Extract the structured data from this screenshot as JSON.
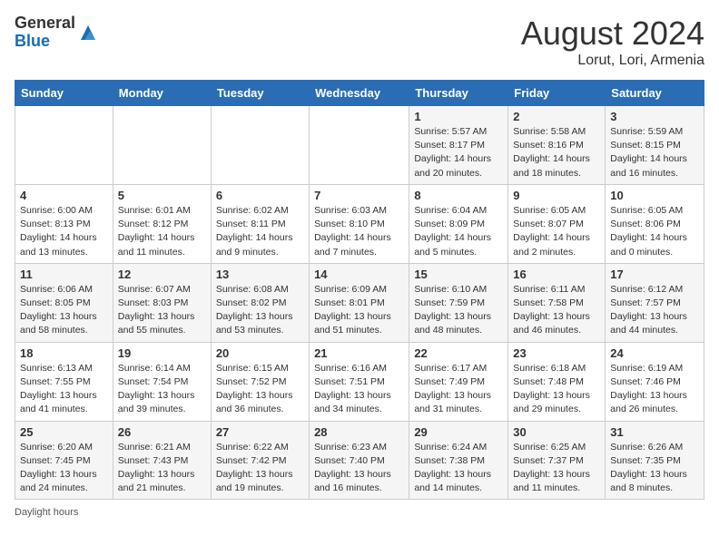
{
  "header": {
    "logo_general": "General",
    "logo_blue": "Blue",
    "month_year": "August 2024",
    "location": "Lorut, Lori, Armenia"
  },
  "days_of_week": [
    "Sunday",
    "Monday",
    "Tuesday",
    "Wednesday",
    "Thursday",
    "Friday",
    "Saturday"
  ],
  "weeks": [
    [
      {
        "day": "",
        "info": ""
      },
      {
        "day": "",
        "info": ""
      },
      {
        "day": "",
        "info": ""
      },
      {
        "day": "",
        "info": ""
      },
      {
        "day": "1",
        "info": "Sunrise: 5:57 AM\nSunset: 8:17 PM\nDaylight: 14 hours and 20 minutes."
      },
      {
        "day": "2",
        "info": "Sunrise: 5:58 AM\nSunset: 8:16 PM\nDaylight: 14 hours and 18 minutes."
      },
      {
        "day": "3",
        "info": "Sunrise: 5:59 AM\nSunset: 8:15 PM\nDaylight: 14 hours and 16 minutes."
      }
    ],
    [
      {
        "day": "4",
        "info": "Sunrise: 6:00 AM\nSunset: 8:13 PM\nDaylight: 14 hours and 13 minutes."
      },
      {
        "day": "5",
        "info": "Sunrise: 6:01 AM\nSunset: 8:12 PM\nDaylight: 14 hours and 11 minutes."
      },
      {
        "day": "6",
        "info": "Sunrise: 6:02 AM\nSunset: 8:11 PM\nDaylight: 14 hours and 9 minutes."
      },
      {
        "day": "7",
        "info": "Sunrise: 6:03 AM\nSunset: 8:10 PM\nDaylight: 14 hours and 7 minutes."
      },
      {
        "day": "8",
        "info": "Sunrise: 6:04 AM\nSunset: 8:09 PM\nDaylight: 14 hours and 5 minutes."
      },
      {
        "day": "9",
        "info": "Sunrise: 6:05 AM\nSunset: 8:07 PM\nDaylight: 14 hours and 2 minutes."
      },
      {
        "day": "10",
        "info": "Sunrise: 6:05 AM\nSunset: 8:06 PM\nDaylight: 14 hours and 0 minutes."
      }
    ],
    [
      {
        "day": "11",
        "info": "Sunrise: 6:06 AM\nSunset: 8:05 PM\nDaylight: 13 hours and 58 minutes."
      },
      {
        "day": "12",
        "info": "Sunrise: 6:07 AM\nSunset: 8:03 PM\nDaylight: 13 hours and 55 minutes."
      },
      {
        "day": "13",
        "info": "Sunrise: 6:08 AM\nSunset: 8:02 PM\nDaylight: 13 hours and 53 minutes."
      },
      {
        "day": "14",
        "info": "Sunrise: 6:09 AM\nSunset: 8:01 PM\nDaylight: 13 hours and 51 minutes."
      },
      {
        "day": "15",
        "info": "Sunrise: 6:10 AM\nSunset: 7:59 PM\nDaylight: 13 hours and 48 minutes."
      },
      {
        "day": "16",
        "info": "Sunrise: 6:11 AM\nSunset: 7:58 PM\nDaylight: 13 hours and 46 minutes."
      },
      {
        "day": "17",
        "info": "Sunrise: 6:12 AM\nSunset: 7:57 PM\nDaylight: 13 hours and 44 minutes."
      }
    ],
    [
      {
        "day": "18",
        "info": "Sunrise: 6:13 AM\nSunset: 7:55 PM\nDaylight: 13 hours and 41 minutes."
      },
      {
        "day": "19",
        "info": "Sunrise: 6:14 AM\nSunset: 7:54 PM\nDaylight: 13 hours and 39 minutes."
      },
      {
        "day": "20",
        "info": "Sunrise: 6:15 AM\nSunset: 7:52 PM\nDaylight: 13 hours and 36 minutes."
      },
      {
        "day": "21",
        "info": "Sunrise: 6:16 AM\nSunset: 7:51 PM\nDaylight: 13 hours and 34 minutes."
      },
      {
        "day": "22",
        "info": "Sunrise: 6:17 AM\nSunset: 7:49 PM\nDaylight: 13 hours and 31 minutes."
      },
      {
        "day": "23",
        "info": "Sunrise: 6:18 AM\nSunset: 7:48 PM\nDaylight: 13 hours and 29 minutes."
      },
      {
        "day": "24",
        "info": "Sunrise: 6:19 AM\nSunset: 7:46 PM\nDaylight: 13 hours and 26 minutes."
      }
    ],
    [
      {
        "day": "25",
        "info": "Sunrise: 6:20 AM\nSunset: 7:45 PM\nDaylight: 13 hours and 24 minutes."
      },
      {
        "day": "26",
        "info": "Sunrise: 6:21 AM\nSunset: 7:43 PM\nDaylight: 13 hours and 21 minutes."
      },
      {
        "day": "27",
        "info": "Sunrise: 6:22 AM\nSunset: 7:42 PM\nDaylight: 13 hours and 19 minutes."
      },
      {
        "day": "28",
        "info": "Sunrise: 6:23 AM\nSunset: 7:40 PM\nDaylight: 13 hours and 16 minutes."
      },
      {
        "day": "29",
        "info": "Sunrise: 6:24 AM\nSunset: 7:38 PM\nDaylight: 13 hours and 14 minutes."
      },
      {
        "day": "30",
        "info": "Sunrise: 6:25 AM\nSunset: 7:37 PM\nDaylight: 13 hours and 11 minutes."
      },
      {
        "day": "31",
        "info": "Sunrise: 6:26 AM\nSunset: 7:35 PM\nDaylight: 13 hours and 8 minutes."
      }
    ]
  ],
  "footer": {
    "daylight_label": "Daylight hours"
  }
}
